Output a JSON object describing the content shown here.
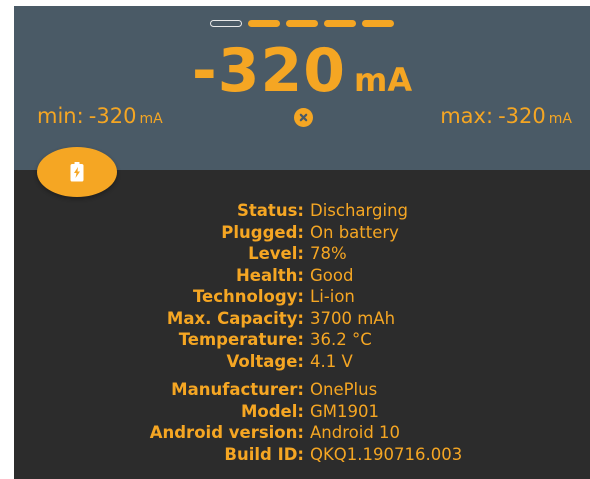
{
  "page_indicator": {
    "count": 5,
    "active_index": 0
  },
  "current": {
    "value": "-320",
    "unit": "mA"
  },
  "min": {
    "label": "min:",
    "value": "-320",
    "unit": "mA"
  },
  "max": {
    "label": "max:",
    "value": "-320",
    "unit": "mA"
  },
  "icons": {
    "reset": "close-circle-icon",
    "fab": "battery-charging-icon"
  },
  "colors": {
    "accent": "#f5a623",
    "top_panel": "#4a5a66",
    "bottom_panel": "#2c2c2c"
  },
  "battery_info": [
    {
      "label": "Status:",
      "value": "Discharging"
    },
    {
      "label": "Plugged:",
      "value": "On battery"
    },
    {
      "label": "Level:",
      "value": "78%"
    },
    {
      "label": "Health:",
      "value": "Good"
    },
    {
      "label": "Technology:",
      "value": "Li-ion"
    },
    {
      "label": "Max. Capacity:",
      "value": "3700 mAh"
    },
    {
      "label": "Temperature:",
      "value": "36.2 °C"
    },
    {
      "label": "Voltage:",
      "value": "4.1 V"
    }
  ],
  "device_info": [
    {
      "label": "Manufacturer:",
      "value": "OnePlus"
    },
    {
      "label": "Model:",
      "value": "GM1901"
    },
    {
      "label": "Android version:",
      "value": "Android 10"
    },
    {
      "label": "Build ID:",
      "value": "QKQ1.190716.003"
    }
  ]
}
